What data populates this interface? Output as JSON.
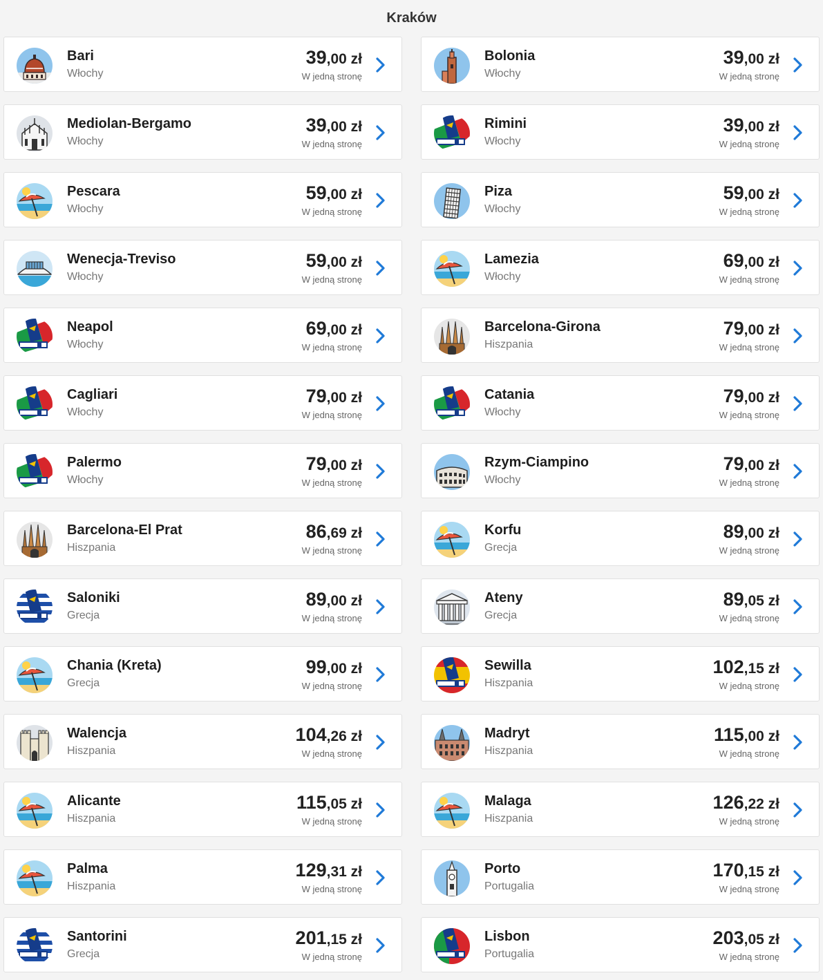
{
  "header": {
    "title": "Kraków"
  },
  "colors": {
    "accent": "#1f7ad8",
    "card_bg": "#ffffff",
    "page_bg": "#f4f4f4"
  },
  "destinations": [
    {
      "city": "Bari",
      "country": "Włochy",
      "price_int": "39",
      "price_dec": ",00",
      "currency": "zł",
      "note": "W jedną stronę",
      "icon": "cathedral-dome-icon"
    },
    {
      "city": "Bolonia",
      "country": "Włochy",
      "price_int": "39",
      "price_dec": ",00",
      "currency": "zł",
      "note": "W jedną stronę",
      "icon": "tower-icon"
    },
    {
      "city": "Mediolan-Bergamo",
      "country": "Włochy",
      "price_int": "39",
      "price_dec": ",00",
      "currency": "zł",
      "note": "W jedną stronę",
      "icon": "gothic-cathedral-icon"
    },
    {
      "city": "Rimini",
      "country": "Włochy",
      "price_int": "39",
      "price_dec": ",00",
      "currency": "zł",
      "note": "W jedną stronę",
      "icon": "plane-tail-italy-icon"
    },
    {
      "city": "Pescara",
      "country": "Włochy",
      "price_int": "59",
      "price_dec": ",00",
      "currency": "zł",
      "note": "W jedną stronę",
      "icon": "beach-umbrella-icon"
    },
    {
      "city": "Piza",
      "country": "Włochy",
      "price_int": "59",
      "price_dec": ",00",
      "currency": "zł",
      "note": "W jedną stronę",
      "icon": "leaning-tower-icon"
    },
    {
      "city": "Wenecja-Treviso",
      "country": "Włochy",
      "price_int": "59",
      "price_dec": ",00",
      "currency": "zł",
      "note": "W jedną stronę",
      "icon": "bridge-icon"
    },
    {
      "city": "Lamezia",
      "country": "Włochy",
      "price_int": "69",
      "price_dec": ",00",
      "currency": "zł",
      "note": "W jedną stronę",
      "icon": "beach-umbrella-icon"
    },
    {
      "city": "Neapol",
      "country": "Włochy",
      "price_int": "69",
      "price_dec": ",00",
      "currency": "zł",
      "note": "W jedną stronę",
      "icon": "plane-tail-italy-icon"
    },
    {
      "city": "Barcelona-Girona",
      "country": "Hiszpania",
      "price_int": "79",
      "price_dec": ",00",
      "currency": "zł",
      "note": "W jedną stronę",
      "icon": "sagrada-familia-icon"
    },
    {
      "city": "Cagliari",
      "country": "Włochy",
      "price_int": "79",
      "price_dec": ",00",
      "currency": "zł",
      "note": "W jedną stronę",
      "icon": "plane-tail-italy-icon"
    },
    {
      "city": "Catania",
      "country": "Włochy",
      "price_int": "79",
      "price_dec": ",00",
      "currency": "zł",
      "note": "W jedną stronę",
      "icon": "plane-tail-italy-icon"
    },
    {
      "city": "Palermo",
      "country": "Włochy",
      "price_int": "79",
      "price_dec": ",00",
      "currency": "zł",
      "note": "W jedną stronę",
      "icon": "plane-tail-italy-icon"
    },
    {
      "city": "Rzym-Ciampino",
      "country": "Włochy",
      "price_int": "79",
      "price_dec": ",00",
      "currency": "zł",
      "note": "W jedną stronę",
      "icon": "colosseum-icon"
    },
    {
      "city": "Barcelona-El Prat",
      "country": "Hiszpania",
      "price_int": "86",
      "price_dec": ",69",
      "currency": "zł",
      "note": "W jedną stronę",
      "icon": "sagrada-familia-icon"
    },
    {
      "city": "Korfu",
      "country": "Grecja",
      "price_int": "89",
      "price_dec": ",00",
      "currency": "zł",
      "note": "W jedną stronę",
      "icon": "beach-umbrella-icon"
    },
    {
      "city": "Saloniki",
      "country": "Grecja",
      "price_int": "89",
      "price_dec": ",00",
      "currency": "zł",
      "note": "W jedną stronę",
      "icon": "plane-tail-greece-icon"
    },
    {
      "city": "Ateny",
      "country": "Grecja",
      "price_int": "89",
      "price_dec": ",05",
      "currency": "zł",
      "note": "W jedną stronę",
      "icon": "parthenon-icon"
    },
    {
      "city": "Chania (Kreta)",
      "country": "Grecja",
      "price_int": "99",
      "price_dec": ",00",
      "currency": "zł",
      "note": "W jedną stronę",
      "icon": "beach-umbrella-icon"
    },
    {
      "city": "Sewilla",
      "country": "Hiszpania",
      "price_int": "102",
      "price_dec": ",15",
      "currency": "zł",
      "note": "W jedną stronę",
      "icon": "plane-tail-spain-icon"
    },
    {
      "city": "Walencja",
      "country": "Hiszpania",
      "price_int": "104",
      "price_dec": ",26",
      "currency": "zł",
      "note": "W jedną stronę",
      "icon": "city-gate-icon"
    },
    {
      "city": "Madryt",
      "country": "Hiszpania",
      "price_int": "115",
      "price_dec": ",00",
      "currency": "zł",
      "note": "W jedną stronę",
      "icon": "palace-icon"
    },
    {
      "city": "Alicante",
      "country": "Hiszpania",
      "price_int": "115",
      "price_dec": ",05",
      "currency": "zł",
      "note": "W jedną stronę",
      "icon": "beach-umbrella-icon"
    },
    {
      "city": "Malaga",
      "country": "Hiszpania",
      "price_int": "126",
      "price_dec": ",22",
      "currency": "zł",
      "note": "W jedną stronę",
      "icon": "beach-umbrella-icon"
    },
    {
      "city": "Palma",
      "country": "Hiszpania",
      "price_int": "129",
      "price_dec": ",31",
      "currency": "zł",
      "note": "W jedną stronę",
      "icon": "beach-umbrella-icon"
    },
    {
      "city": "Porto",
      "country": "Portugalia",
      "price_int": "170",
      "price_dec": ",15",
      "currency": "zł",
      "note": "W jedną stronę",
      "icon": "clock-tower-icon"
    },
    {
      "city": "Santorini",
      "country": "Grecja",
      "price_int": "201",
      "price_dec": ",15",
      "currency": "zł",
      "note": "W jedną stronę",
      "icon": "plane-tail-greece-icon"
    },
    {
      "city": "Lisbon",
      "country": "Portugalia",
      "price_int": "203",
      "price_dec": ",05",
      "currency": "zł",
      "note": "W jedną stronę",
      "icon": "plane-tail-portugal-icon"
    }
  ]
}
